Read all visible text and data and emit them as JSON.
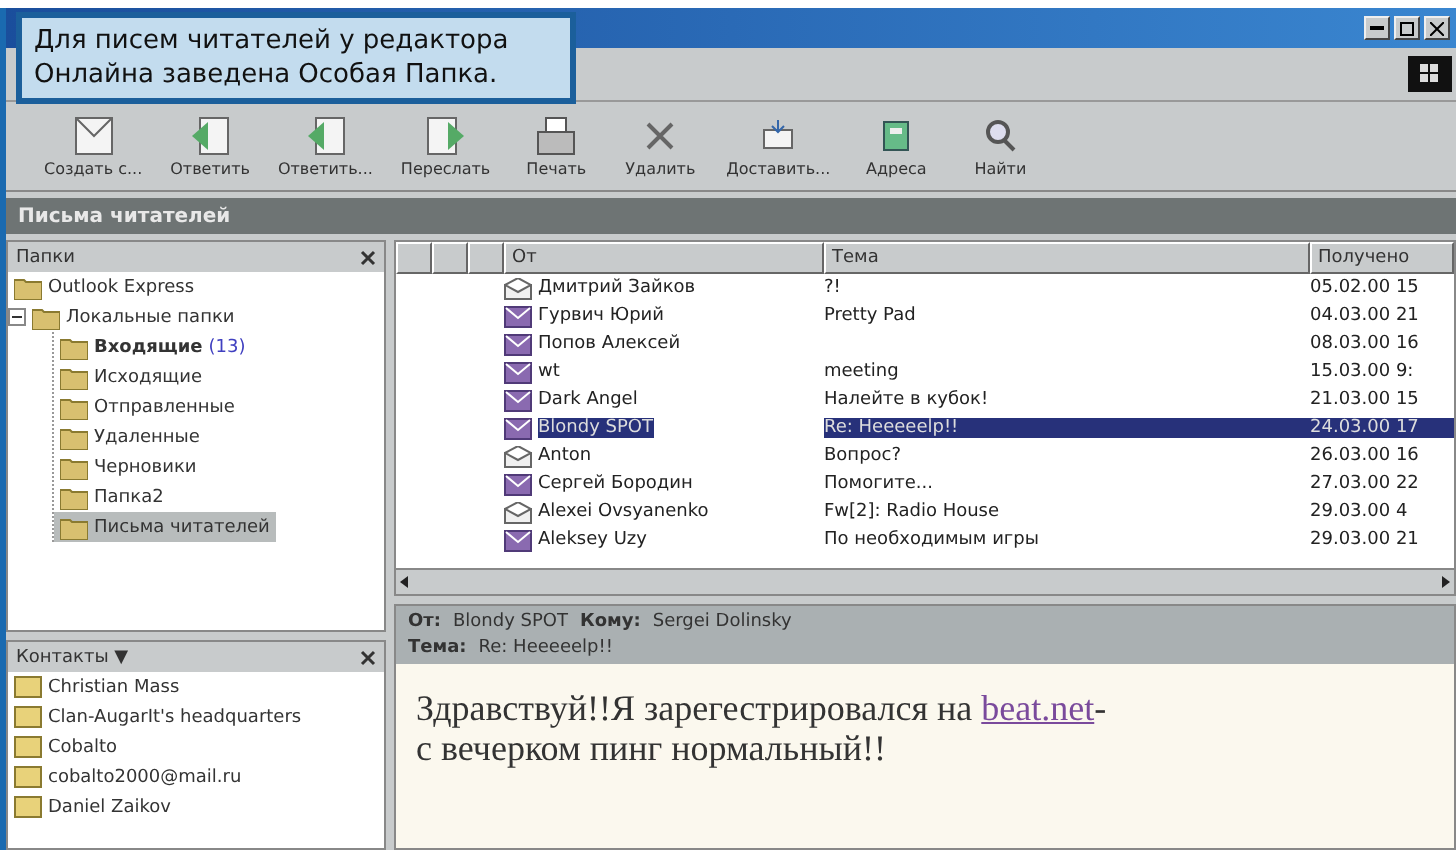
{
  "caption": "Для писем читателей у редактора Онлайна заведена Особая Папка.",
  "toolbar": [
    {
      "label": "Создать с..."
    },
    {
      "label": "Ответить"
    },
    {
      "label": "Ответить..."
    },
    {
      "label": "Переслать"
    },
    {
      "label": "Печать"
    },
    {
      "label": "Удалить"
    },
    {
      "label": "Доставить..."
    },
    {
      "label": "Адреса"
    },
    {
      "label": "Найти"
    }
  ],
  "folder_bar": {
    "title": "Письма читателей"
  },
  "folders": {
    "title": "Папки",
    "tree": [
      {
        "label": "Outlook Express",
        "selected": false
      },
      {
        "label": "Локальные папки",
        "selected": false,
        "expanded": true,
        "children": [
          {
            "label": "Входящие",
            "count": "(13)",
            "selected": false
          },
          {
            "label": "Исходящие",
            "selected": false
          },
          {
            "label": "Отправленные",
            "selected": false
          },
          {
            "label": "Удаленные",
            "selected": false
          },
          {
            "label": "Черновики",
            "selected": false
          },
          {
            "label": "Папка2",
            "selected": false
          },
          {
            "label": "Письма читателей",
            "selected": true
          }
        ]
      }
    ]
  },
  "contacts": {
    "title": "Контакты ▼",
    "items": [
      "Christian Mass",
      "Clan-AugarIt's headquarters",
      "Cobalto",
      "cobalto2000@mail.ru",
      "Daniel Zaikov"
    ]
  },
  "messages": {
    "columns": [
      "От",
      "Тема",
      "Получено"
    ],
    "rows": [
      {
        "from": "Дмитрий Зайков",
        "subject": "?!",
        "received": "05.02.00 15",
        "unread": false,
        "selected": false
      },
      {
        "from": "Гурвич Юрий",
        "subject": "Pretty Pad",
        "received": "04.03.00 21",
        "unread": true,
        "selected": false
      },
      {
        "from": "Попов Алексей",
        "subject": "",
        "received": "08.03.00 16",
        "unread": true,
        "selected": false
      },
      {
        "from": "wt",
        "subject": "meeting",
        "received": "15.03.00 9:",
        "unread": true,
        "selected": false
      },
      {
        "from": "Dark Angel",
        "subject": "Налейте в кубок!",
        "received": "21.03.00 15",
        "unread": true,
        "selected": false
      },
      {
        "from": "Blondy SPOT",
        "subject": "Re: Heeeeelp!!",
        "received": "24.03.00 17",
        "unread": true,
        "selected": true
      },
      {
        "from": "Anton",
        "subject": "Вопрос?",
        "received": "26.03.00 16",
        "unread": false,
        "selected": false
      },
      {
        "from": "Сергей Бородин",
        "subject": "Помогите...",
        "received": "27.03.00 22",
        "unread": true,
        "selected": false
      },
      {
        "from": "Alexei Ovsyanenko",
        "subject": "Fw[2]: Radio House",
        "received": "29.03.00 4",
        "unread": false,
        "selected": false
      },
      {
        "from": "Aleksey Uzy",
        "subject": "По необходимым игры",
        "received": "29.03.00 21",
        "unread": true,
        "selected": false
      }
    ]
  },
  "preview": {
    "from_label": "От:",
    "from": "Blondy SPOT",
    "to_label": "Кому:",
    "to": "Sergei Dolinsky",
    "subject_label": "Тема:",
    "subject": "Re: Heeeeelp!!",
    "body_text": "Здравствуй!!Я зарегестрировался на",
    "link": "beat.net",
    "after_link": "-",
    "body_line2": "с вечерком пинг нормальный!!"
  }
}
